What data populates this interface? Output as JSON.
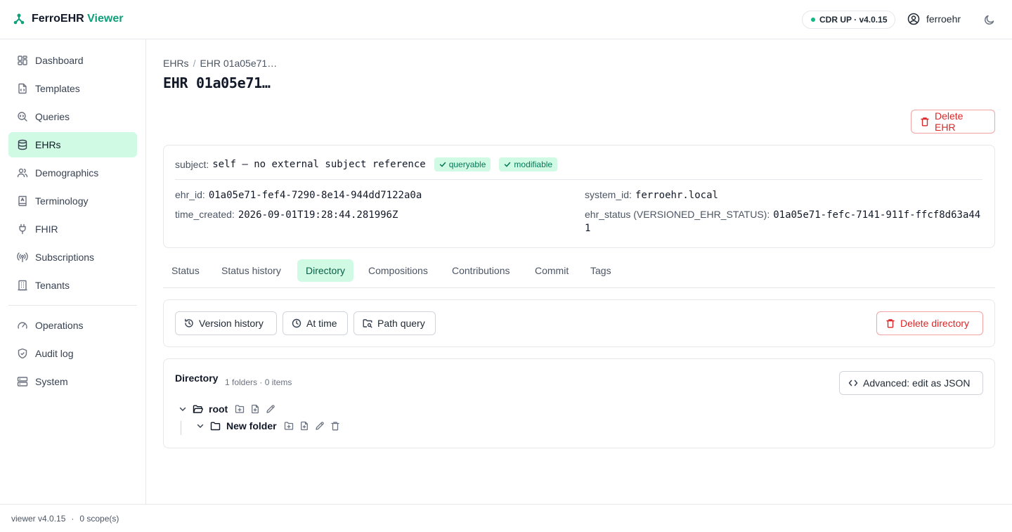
{
  "header": {
    "brand_name": "FerroEHR",
    "brand_accent": "Viewer",
    "cdr_status": "CDR UP · v4.0.15",
    "username": "ferroehr",
    "colors": {
      "accent": "#0f9f7a",
      "active_bg": "#d1fae5",
      "danger": "#dc2626"
    }
  },
  "sidebar": {
    "items": [
      {
        "label": "Dashboard",
        "icon": "dashboard-icon"
      },
      {
        "label": "Templates",
        "icon": "file-code-icon"
      },
      {
        "label": "Queries",
        "icon": "search-query-icon"
      },
      {
        "label": "EHRs",
        "icon": "database-icon",
        "active": true
      },
      {
        "label": "Demographics",
        "icon": "users-icon"
      },
      {
        "label": "Terminology",
        "icon": "book-icon"
      },
      {
        "label": "FHIR",
        "icon": "plug-icon"
      },
      {
        "label": "Subscriptions",
        "icon": "broadcast-icon"
      },
      {
        "label": "Tenants",
        "icon": "building-icon"
      },
      {
        "label": "Operations",
        "icon": "gauge-icon"
      },
      {
        "label": "Audit log",
        "icon": "shield-icon"
      },
      {
        "label": "System",
        "icon": "server-icon"
      }
    ]
  },
  "footer": {
    "version": "viewer v4.0.15",
    "separator": "·",
    "scopes": "0 scope(s)"
  },
  "main": {
    "breadcrumb": {
      "root": "EHRs",
      "separator": "/",
      "current": "EHR 01a05e71…"
    },
    "title": "EHR 01a05e71…",
    "delete_ehr_label": "Delete EHR",
    "summary": {
      "subject_label": "subject:",
      "subject_value": "self — no external subject reference",
      "badges": [
        "queryable",
        "modifiable"
      ],
      "ehr_id_label": "ehr_id:",
      "ehr_id_value": "01a05e71-fef4-7290-8e14-944dd7122a0a",
      "time_created_label": "time_created:",
      "time_created_value": "2026-09-01T19:28:44.281996Z",
      "system_id_label": "system_id:",
      "system_id_value": "ferroehr.local",
      "ehr_status_label": "ehr_status (VERSIONED_EHR_STATUS):",
      "ehr_status_value_line1": "01a05e71-fefc-7141-911f-ffcf8d63a44",
      "ehr_status_value_line2": "1"
    },
    "tabs": [
      {
        "label": "Status"
      },
      {
        "label": "Status history"
      },
      {
        "label": "Directory",
        "active": true
      },
      {
        "label": "Compositions"
      },
      {
        "label": "Contributions"
      },
      {
        "label": "Commit"
      },
      {
        "label": "Tags"
      }
    ],
    "toolbar": {
      "version_history": "Version history",
      "at_time": "At time",
      "path_query": "Path query",
      "delete_directory": "Delete directory"
    },
    "directory": {
      "title": "Directory",
      "meta": "1 folders · 0 items",
      "advanced_label": "Advanced: edit as JSON",
      "tree": [
        {
          "name": "root",
          "level": 0
        },
        {
          "name": "New folder",
          "level": 1
        }
      ]
    }
  }
}
